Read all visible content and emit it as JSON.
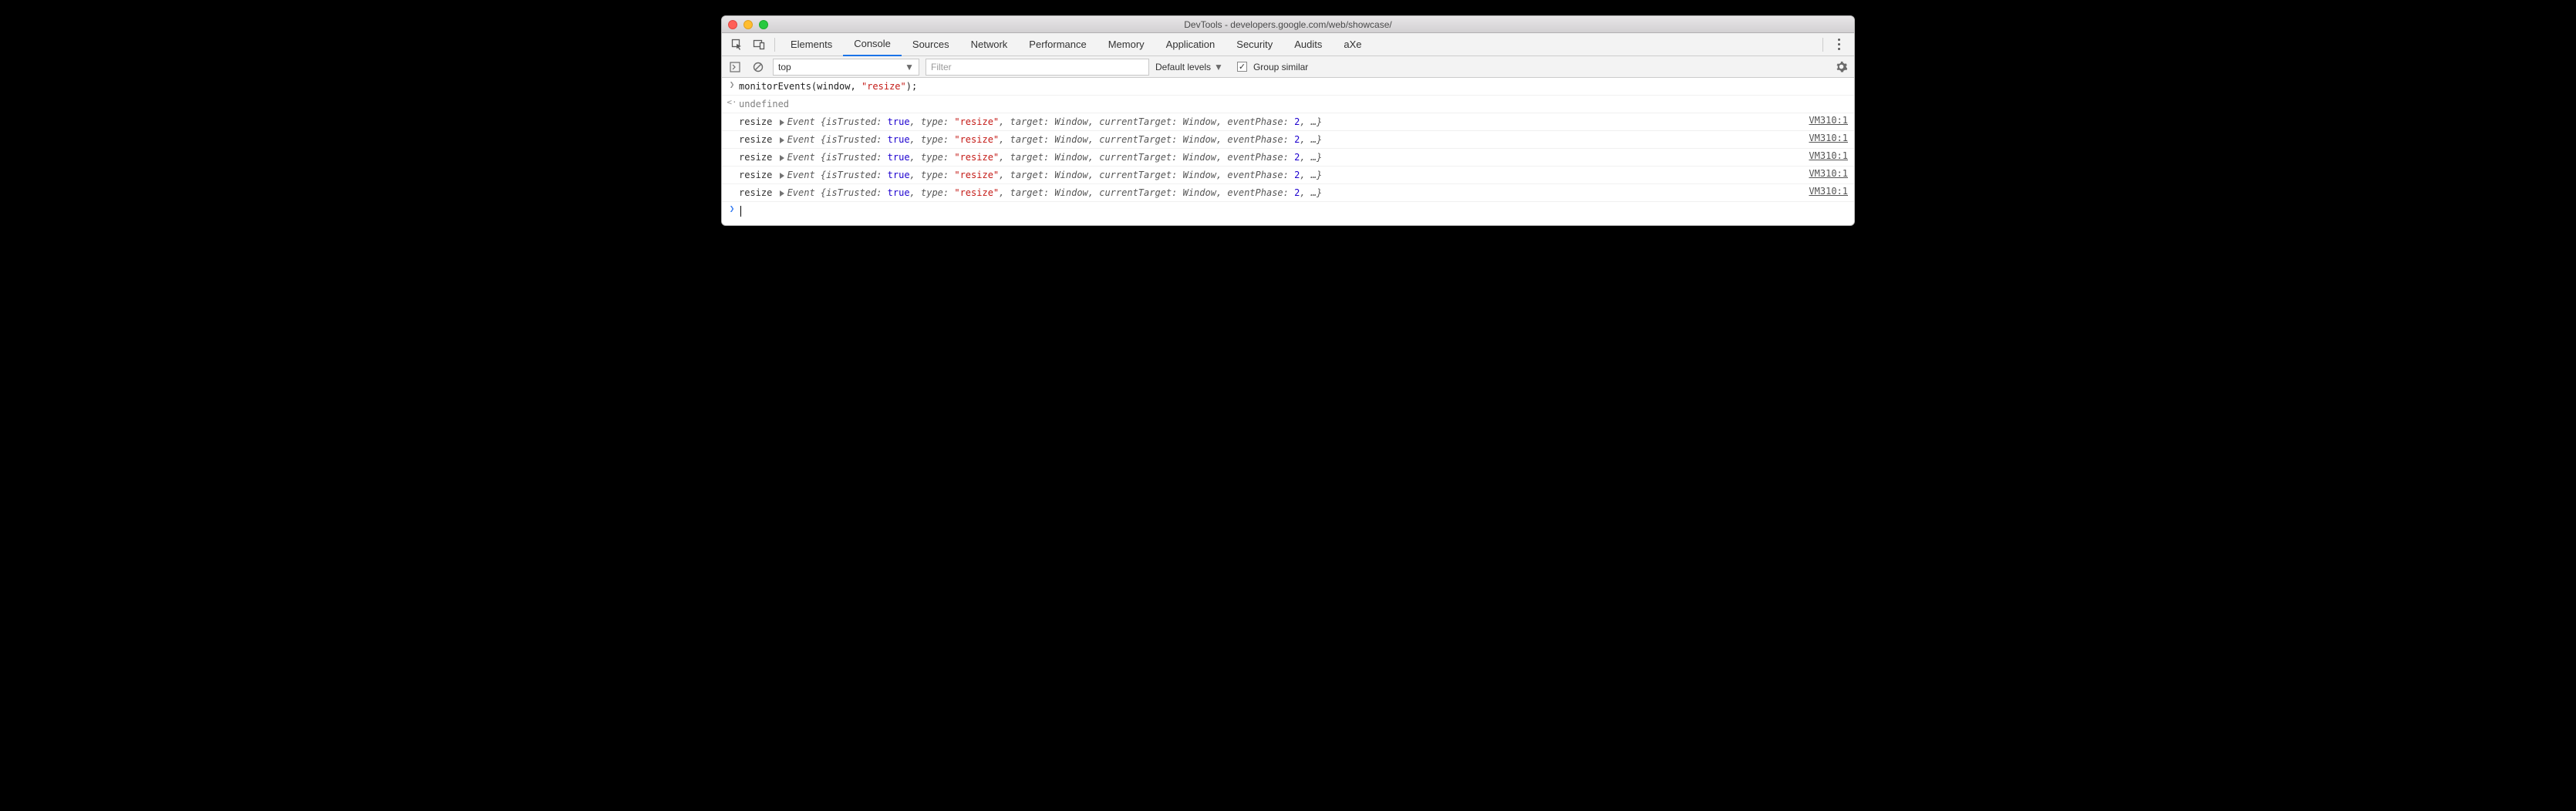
{
  "window": {
    "title": "DevTools - developers.google.com/web/showcase/"
  },
  "tabs": {
    "items": [
      "Elements",
      "Console",
      "Sources",
      "Network",
      "Performance",
      "Memory",
      "Application",
      "Security",
      "Audits",
      "aXe"
    ],
    "active_index": 1
  },
  "toolbar": {
    "context": "top",
    "filter_placeholder": "Filter",
    "levels_label": "Default levels",
    "group_similar_label": "Group similar",
    "group_similar_checked": true
  },
  "console_entries": {
    "input": {
      "code_prefix": "monitorEvents(window, ",
      "code_str": "\"resize\"",
      "code_suffix": ");"
    },
    "result": {
      "text": "undefined"
    },
    "events": [
      {
        "label": "resize",
        "object": "Event",
        "props": {
          "isTrusted": "true",
          "type": "\"resize\"",
          "target": "Window",
          "currentTarget": "Window",
          "eventPhase": "2"
        },
        "source": "VM310:1"
      },
      {
        "label": "resize",
        "object": "Event",
        "props": {
          "isTrusted": "true",
          "type": "\"resize\"",
          "target": "Window",
          "currentTarget": "Window",
          "eventPhase": "2"
        },
        "source": "VM310:1"
      },
      {
        "label": "resize",
        "object": "Event",
        "props": {
          "isTrusted": "true",
          "type": "\"resize\"",
          "target": "Window",
          "currentTarget": "Window",
          "eventPhase": "2"
        },
        "source": "VM310:1"
      },
      {
        "label": "resize",
        "object": "Event",
        "props": {
          "isTrusted": "true",
          "type": "\"resize\"",
          "target": "Window",
          "currentTarget": "Window",
          "eventPhase": "2"
        },
        "source": "VM310:1"
      },
      {
        "label": "resize",
        "object": "Event",
        "props": {
          "isTrusted": "true",
          "type": "\"resize\"",
          "target": "Window",
          "currentTarget": "Window",
          "eventPhase": "2"
        },
        "source": "VM310:1"
      }
    ]
  }
}
